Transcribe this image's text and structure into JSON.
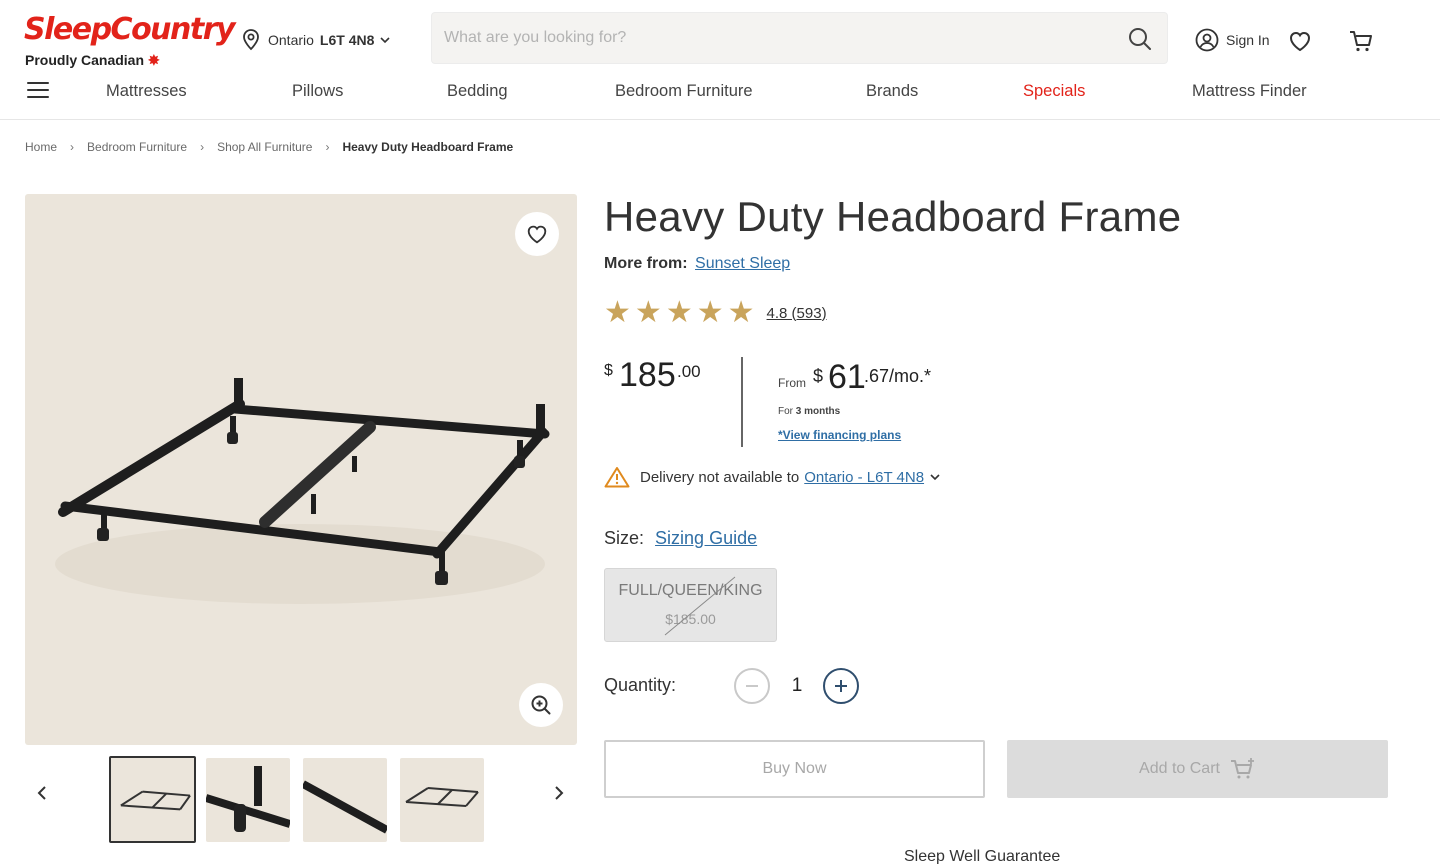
{
  "header": {
    "logo_main": "SleepCountry",
    "logo_sub": "Proudly Canadian",
    "location_region": "Ontario",
    "location_postal": "L6T 4N8",
    "search_placeholder": "What are you looking for?",
    "signin_label": "Sign In"
  },
  "nav": {
    "items": [
      "Mattresses",
      "Pillows",
      "Bedding",
      "Bedroom Furniture",
      "Brands",
      "Specials",
      "Mattress Finder"
    ]
  },
  "breadcrumb": [
    "Home",
    "Bedroom Furniture",
    "Shop All Furniture",
    "Heavy Duty Headboard Frame"
  ],
  "product": {
    "title": "Heavy Duty Headboard Frame",
    "more_from_label": "More from:",
    "brand": "Sunset Sleep",
    "rating": 4.8,
    "rating_text": "4.8 (593)",
    "price": {
      "currency": "$",
      "dollars": "185",
      "cents": ".00"
    },
    "financing": {
      "from": "From",
      "currency": "$",
      "amount": "61",
      "rest": ".67/mo.*",
      "term_prefix": "For",
      "term": "3 months",
      "plans_link": "*View financing plans"
    },
    "delivery": {
      "text": "Delivery not available to",
      "location": "Ontario - L6T 4N8"
    },
    "size_label": "Size:",
    "sizing_guide": "Sizing Guide",
    "size_option": {
      "name": "FULL/QUEEN/KING",
      "price": "$185.00"
    },
    "quantity_label": "Quantity:",
    "quantity": "1",
    "buy_now": "Buy Now",
    "add_to_cart": "Add to Cart",
    "guarantee": "Sleep Well Guarantee"
  },
  "colors": {
    "brand_red": "#e2231a",
    "link_blue": "#2f6ea5",
    "star_gold": "#c9a45c",
    "image_bg": "#ebe5db"
  },
  "icons": [
    "location-pin-icon",
    "chevron-down-icon",
    "search-icon",
    "user-icon",
    "heart-icon",
    "cart-icon",
    "hamburger-icon",
    "zoom-icon",
    "warning-icon",
    "minus-icon",
    "plus-icon",
    "chevron-left-icon",
    "chevron-right-icon",
    "cart-plus-icon"
  ]
}
